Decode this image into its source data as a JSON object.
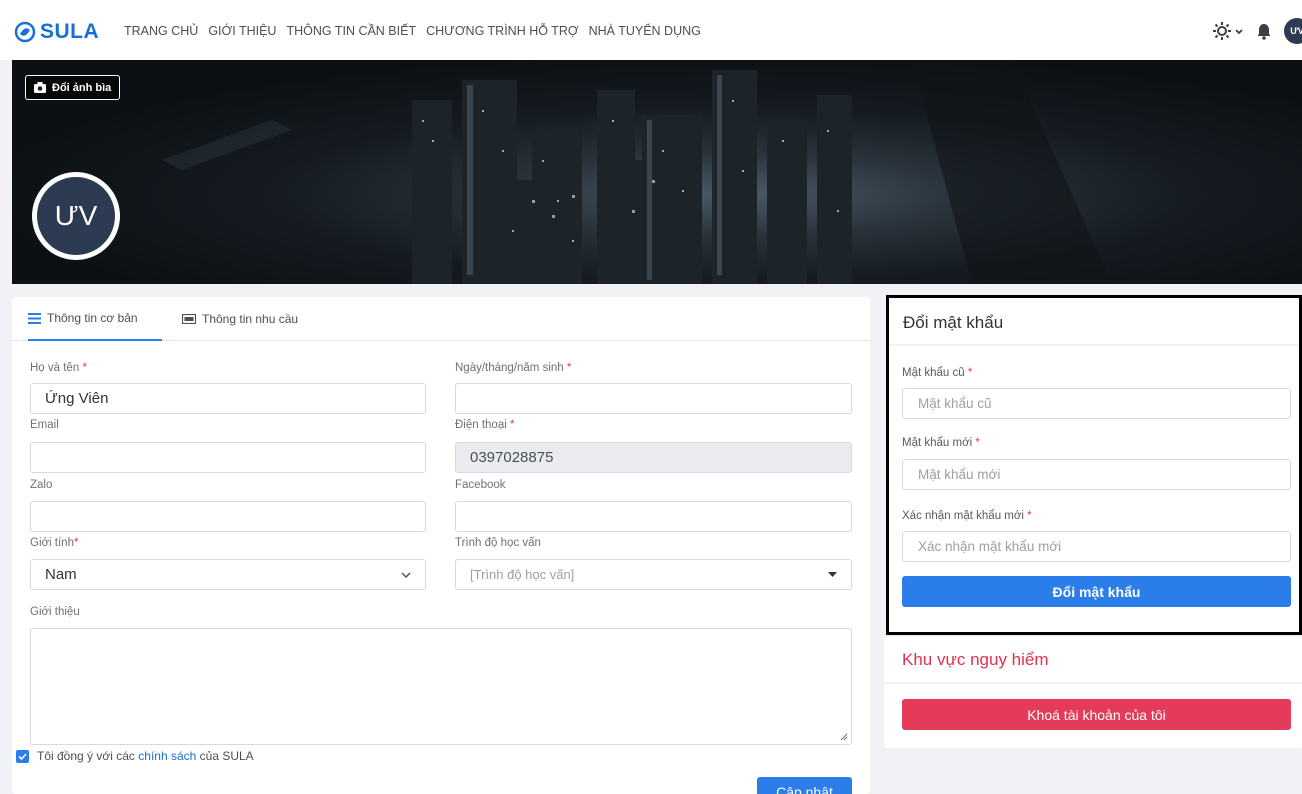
{
  "brand": {
    "name": "SULA"
  },
  "nav": {
    "links": [
      "TRANG CHỦ",
      "GIỚI THIỆU",
      "THÔNG TIN CẦN BIẾT",
      "CHƯƠNG TRÌNH HỖ TRỢ",
      "NHÀ TUYỂN DỤNG"
    ],
    "avatar_initials": "ƯV",
    "icons": [
      "sun-icon",
      "chevron-down-icon",
      "bell-icon"
    ]
  },
  "cover": {
    "change_cover_label": "Đổi ảnh bìa",
    "avatar_initials": "ƯV"
  },
  "profile": {
    "tabs": [
      {
        "label": "Thông tin cơ bản",
        "icon": "menu-icon",
        "active": true
      },
      {
        "label": "Thông tin nhu cầu",
        "icon": "card-icon",
        "active": false
      }
    ],
    "fields": {
      "fullname": {
        "label": "Họ và tên",
        "value": "Ứng Viên"
      },
      "birthdate": {
        "label": "Ngày/tháng/năm sinh",
        "value": ""
      },
      "email": {
        "label": "Email",
        "value": ""
      },
      "phone": {
        "label": "Điện thoại",
        "value": "0397028875"
      },
      "zalo": {
        "label": "Zalo",
        "value": ""
      },
      "facebook": {
        "label": "Facebook",
        "value": ""
      },
      "gender": {
        "label": "Giới tính",
        "value": "Nam"
      },
      "education": {
        "label": "Trình độ học vấn",
        "placeholder": "[Trình độ học vấn]"
      },
      "intro": {
        "label": "Giới thiệu",
        "value": ""
      }
    },
    "required_mark": "*",
    "agree": {
      "prefix": "Tôi đồng ý với các",
      "link": "chính sách",
      "suffix": "của SULA",
      "checked": true
    },
    "update_label": "Cập nhật"
  },
  "password": {
    "title": "Đổi mật khẩu",
    "old": {
      "label": "Mật khẩu cũ",
      "placeholder": "Mật khẩu cũ"
    },
    "new": {
      "label": "Mật khẩu mới",
      "placeholder": "Mật khẩu mới"
    },
    "confirm": {
      "label": "Xác nhận mật khẩu mới",
      "placeholder": "Xác nhận mật khẩu mới"
    },
    "submit_label": "Đổi mật khẩu"
  },
  "danger": {
    "title": "Khu vực nguy hiểm",
    "lock_label": "Khoá tài khoản của tôi"
  },
  "colors": {
    "primary": "#2b7de9",
    "danger": "#e43b5a",
    "brand": "#1a6fd6",
    "required": "#e53950"
  }
}
